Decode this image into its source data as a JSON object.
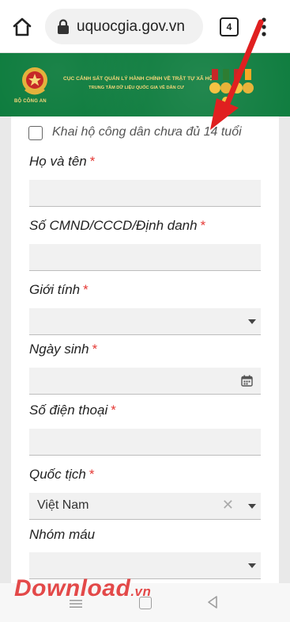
{
  "browser": {
    "url": "uquocgia.gov.vn",
    "tab_count": "4"
  },
  "header": {
    "emblem_caption": "BỘ CÔNG AN",
    "title": "CỤC CẢNH SÁT QUẢN LÝ HÀNH CHÍNH VỀ TRẬT TỰ XÃ HỘI",
    "subtitle": "TRUNG TÂM DỮ LIỆU QUỐC GIA VỀ DÂN CƯ"
  },
  "form": {
    "checkbox_label": "Khai hộ công dân chưa đủ 14 tuổi",
    "checkbox_checked": false,
    "required_mark": "*",
    "fields": [
      {
        "label": "Họ và tên",
        "required": true,
        "type": "text",
        "value": ""
      },
      {
        "label": "Số CMND/CCCD/Định danh",
        "required": true,
        "type": "text",
        "value": ""
      },
      {
        "label": "Giới tính",
        "required": true,
        "type": "select",
        "value": ""
      },
      {
        "label": "Ngày sinh",
        "required": true,
        "type": "date",
        "value": ""
      },
      {
        "label": "Số điện thoại",
        "required": true,
        "type": "text",
        "value": ""
      },
      {
        "label": "Quốc tịch",
        "required": true,
        "type": "select",
        "value": "Việt Nam"
      },
      {
        "label": "Nhóm máu",
        "required": false,
        "type": "select",
        "value": ""
      }
    ]
  },
  "watermark": {
    "text": "Download",
    "tld": ".vn"
  },
  "colors": {
    "header_green": "#0a7a3b",
    "header_gold": "#f6d77a",
    "required_red": "#e53935",
    "annotation_red": "#e02020"
  },
  "icons": [
    "home-icon",
    "lock-icon",
    "tabs-icon",
    "more-vert-icon",
    "calendar-icon",
    "clear-icon",
    "chevron-down-icon",
    "nav-menu-icon",
    "nav-home-icon",
    "nav-back-icon"
  ]
}
